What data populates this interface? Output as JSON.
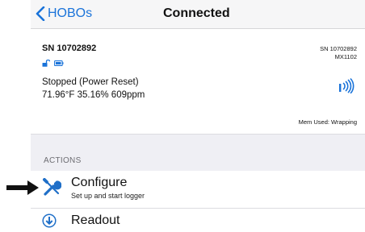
{
  "nav": {
    "back_label": "HOBOs",
    "title": "Connected"
  },
  "device": {
    "serial": "SN 10702892",
    "status": "Stopped (Power Reset)",
    "reading": "71.96°F 35.16% 609ppm",
    "serial_right": "SN 10702892",
    "model": "MX1102",
    "memory": "Mem Used: Wrapping"
  },
  "actions": {
    "header": "ACTIONS",
    "configure": {
      "title": "Configure",
      "subtitle": "Set up and start logger"
    },
    "readout": {
      "title": "Readout"
    }
  },
  "colors": {
    "accent": "#1a73d9",
    "configure_icon": "#1f6fc8",
    "section_bg": "#efeff4"
  }
}
